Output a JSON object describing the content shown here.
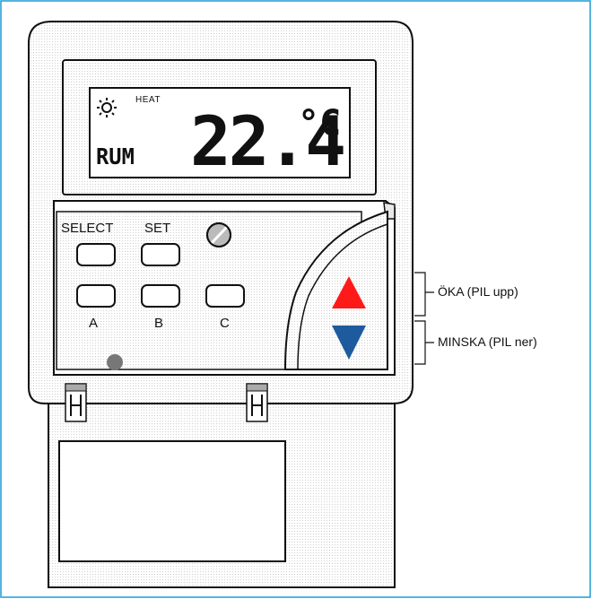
{
  "display": {
    "sun_icon": "sun-icon",
    "mode_label": "HEAT",
    "room_label": "RUM",
    "temperature": "22.4",
    "unit": "°C"
  },
  "buttons": {
    "select_label": "SELECT",
    "set_label": "SET",
    "a_label": "A",
    "b_label": "B",
    "c_label": "C"
  },
  "annotations": {
    "up": "ÖKA (PIL upp)",
    "down": "MINSKA (PIL ner)"
  },
  "colors": {
    "border": "#1e9ad6",
    "up_arrow": "#ff1a1a",
    "down_arrow": "#1e5a9e",
    "led": "#777777"
  }
}
